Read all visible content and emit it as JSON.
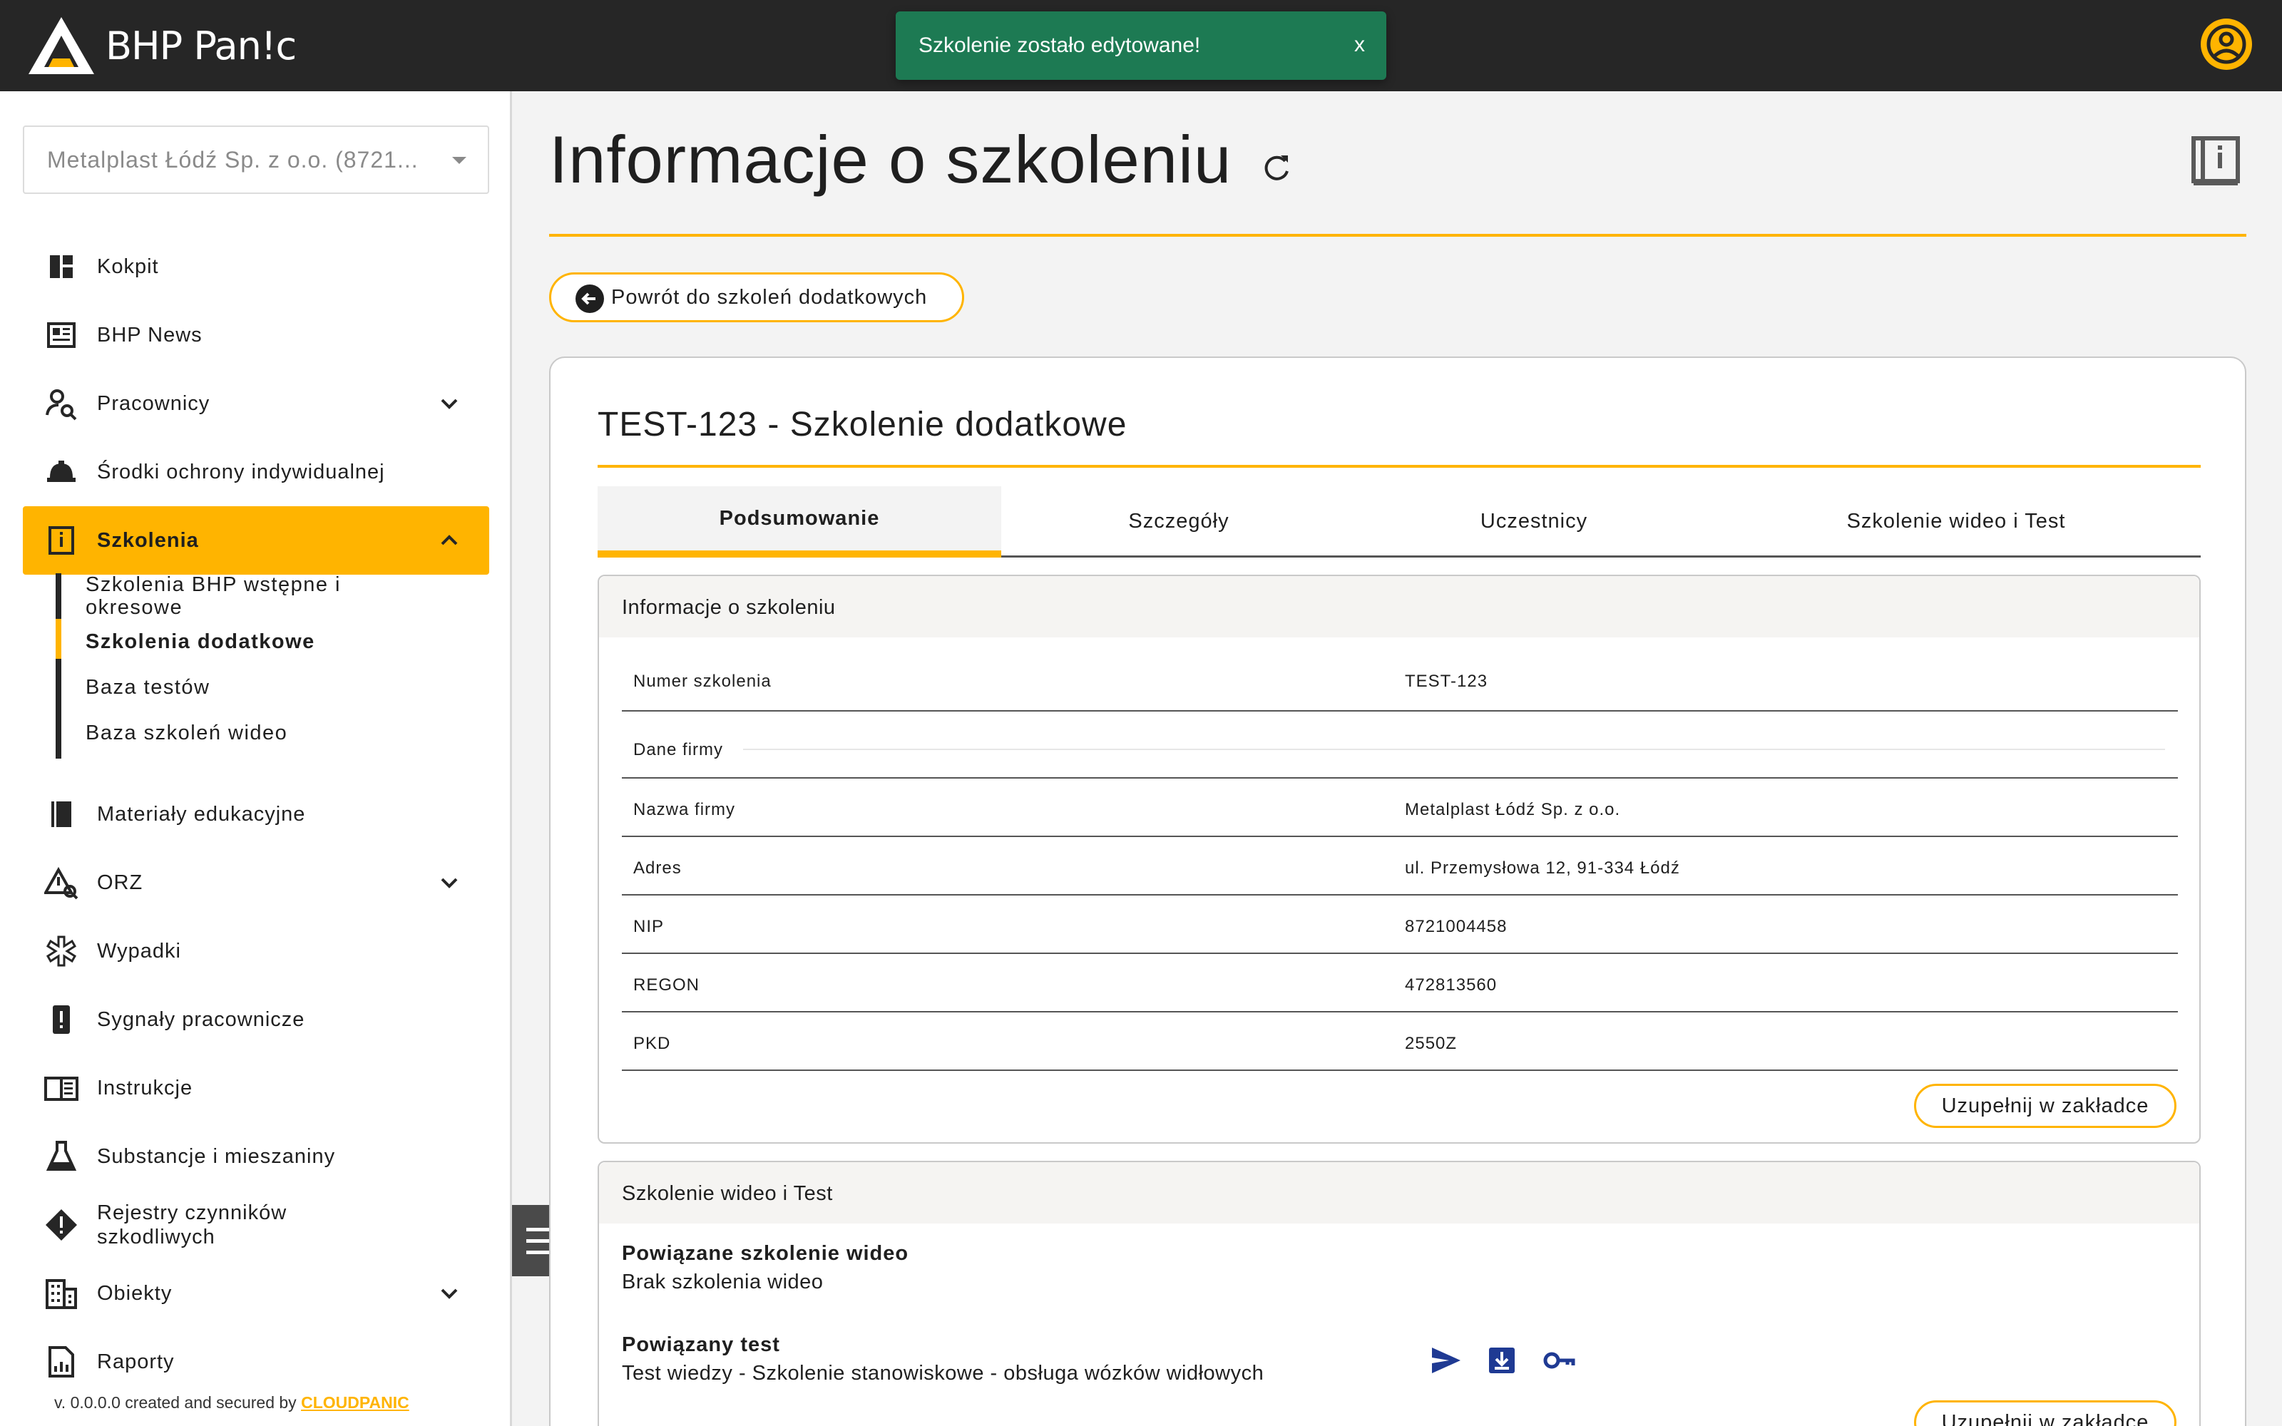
{
  "app": {
    "logo_text": "BHP Pan!c"
  },
  "toast": {
    "message": "Szkolenie zostało edytowane!",
    "close": "x"
  },
  "sidebar": {
    "company": "Metalplast Łódź Sp. z o.o. (8721...",
    "items": [
      {
        "label": "Kokpit",
        "icon": "dashboard-icon"
      },
      {
        "label": "BHP News",
        "icon": "news-icon"
      },
      {
        "label": "Pracownicy",
        "icon": "people-search-icon",
        "expandable": true
      },
      {
        "label": "Środki ochrony indywidualnej",
        "icon": "helmet-icon"
      },
      {
        "label": "Szkolenia",
        "icon": "training-book-icon",
        "expandable": true,
        "active": true
      },
      {
        "label": "Materiały edukacyjne",
        "icon": "book-icon"
      },
      {
        "label": "ORZ",
        "icon": "risk-warning-icon",
        "expandable": true
      },
      {
        "label": "Wypadki",
        "icon": "medical-star-icon"
      },
      {
        "label": "Sygnały pracownicze",
        "icon": "signal-exclamation-icon"
      },
      {
        "label": "Instrukcje",
        "icon": "instruction-book-icon"
      },
      {
        "label": "Substancje i mieszaniny",
        "icon": "flask-icon"
      },
      {
        "label": "Rejestry czynników szkodliwych",
        "icon": "hazard-icon"
      },
      {
        "label": "Obiekty",
        "icon": "building-icon",
        "expandable": true
      },
      {
        "label": "Raporty",
        "icon": "report-icon"
      }
    ],
    "sub_items": [
      {
        "label": "Szkolenia BHP wstępne i okresowe"
      },
      {
        "label": "Szkolenia dodatkowe",
        "active": true
      },
      {
        "label": "Baza testów"
      },
      {
        "label": "Baza szkoleń wideo"
      }
    ],
    "footer_prefix": "v. 0.0.0.0 created and secured by ",
    "footer_brand": "CLOUDPANIC"
  },
  "main": {
    "title": "Informacje o szkoleniu",
    "back_button": "Powrót do szkoleń dodatkowych",
    "card_title": "TEST-123 - Szkolenie dodatkowe",
    "tabs": [
      "Podsumowanie",
      "Szczegóły",
      "Uczestnicy",
      "Szkolenie wideo i Test"
    ],
    "active_tab": "Podsumowanie",
    "info_panel": {
      "title": "Informacje o szkoleniu",
      "rows": [
        {
          "key": "Numer szkolenia",
          "value": "TEST-123"
        },
        {
          "section": "Dane firmy"
        },
        {
          "key": "Nazwa firmy",
          "value": "Metalplast Łódź Sp. z o.o."
        },
        {
          "key": "Adres",
          "value": "ul. Przemysłowa 12, 91-334 Łódź"
        },
        {
          "key": "NIP",
          "value": "8721004458"
        },
        {
          "key": "REGON",
          "value": "472813560"
        },
        {
          "key": "PKD",
          "value": "2550Z"
        }
      ],
      "button": "Uzupełnij w zakładce"
    },
    "video_panel": {
      "title": "Szkolenie wideo i Test",
      "video_label": "Powiązane szkolenie wideo",
      "video_value": "Brak szkolenia wideo",
      "test_label": "Powiązany test",
      "test_value": "Test wiedzy - Szkolenie stanowiskowe - obsługa wózków widłowych",
      "button": "Uzupełnij w zakładce"
    }
  },
  "colors": {
    "accent": "#ffb400",
    "topbar": "#262626",
    "toast": "#1d7a53",
    "icon_blue": "#1f3a93"
  }
}
